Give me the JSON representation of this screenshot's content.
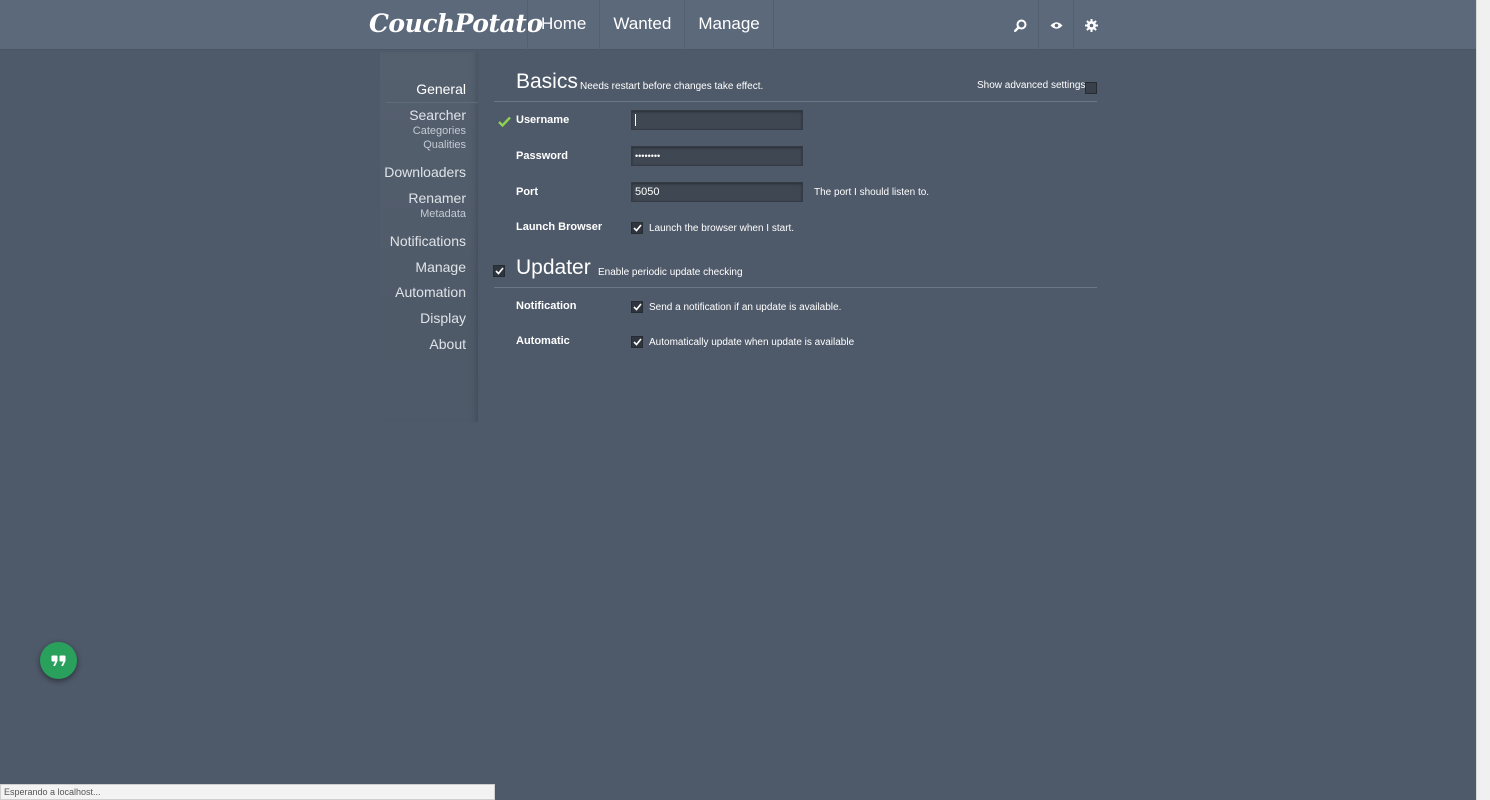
{
  "app": {
    "logo": "CouchPotato"
  },
  "nav": {
    "items": [
      "Home",
      "Wanted",
      "Manage"
    ]
  },
  "header_icons": [
    "search-icon",
    "eye-icon",
    "gear-icon"
  ],
  "sidebar": {
    "items": [
      {
        "label": "General",
        "active": true
      },
      {
        "label": "Searcher",
        "subs": [
          "Categories",
          "Qualities"
        ]
      },
      {
        "label": "Downloaders"
      },
      {
        "label": "Renamer",
        "subs": [
          "Metadata"
        ]
      },
      {
        "label": "Notifications"
      },
      {
        "label": "Manage"
      },
      {
        "label": "Automation"
      },
      {
        "label": "Display"
      },
      {
        "label": "About"
      }
    ]
  },
  "basics": {
    "title": "Basics",
    "description": "Needs restart before changes take effect.",
    "advanced_label": "Show advanced settings",
    "username_label": "Username",
    "username_value": "",
    "password_label": "Password",
    "password_value": "••••••••",
    "port_label": "Port",
    "port_value": "5050",
    "port_hint": "The port I should listen to.",
    "launch_label": "Launch Browser",
    "launch_hint": "Launch the browser when I start."
  },
  "updater": {
    "title": "Updater",
    "description": "Enable periodic update checking",
    "notification_label": "Notification",
    "notification_hint": "Send a notification if an update is available.",
    "automatic_label": "Automatic",
    "automatic_hint": "Automatically update when update is available"
  },
  "status_bar": {
    "text": "Esperando a localhost..."
  },
  "colors": {
    "background": "#4e5969",
    "header": "#5c697b",
    "accent_green": "#2aa05d",
    "valid_check": "#8fd14f"
  }
}
